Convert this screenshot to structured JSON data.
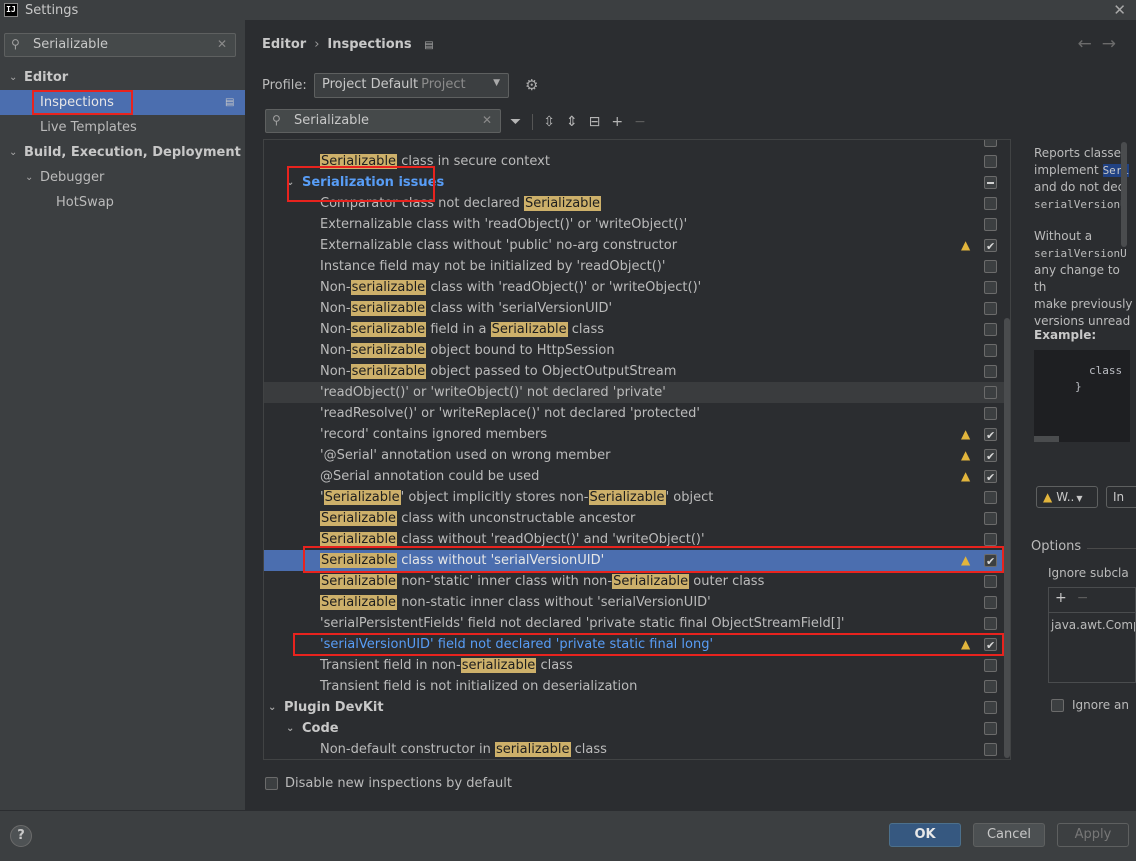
{
  "window": {
    "title": "Settings",
    "app_icon_text": "IJ"
  },
  "sidebar": {
    "search_value": "Serializable",
    "items": [
      {
        "label": "Editor"
      },
      {
        "label": "Inspections"
      },
      {
        "label": "Live Templates"
      },
      {
        "label": "Build, Execution, Deployment"
      },
      {
        "label": "Debugger"
      },
      {
        "label": "HotSwap"
      }
    ]
  },
  "breadcrumb": {
    "parent": "Editor",
    "current": "Inspections"
  },
  "profile": {
    "label": "Profile:",
    "value": "Project Default",
    "sub": "Project"
  },
  "inspection_search": {
    "value": "Serializable"
  },
  "list": {
    "partial_row": {
      "pre": "",
      "hl": "Serializable",
      "post": " class in secure context"
    },
    "group_serialization": "Serialization issues",
    "rows": [
      {
        "pre": "Comparator class not declared ",
        "hl": "Serializable",
        "post": ""
      },
      {
        "pre": "Externalizable class with 'readObject()' or 'writeObject()'",
        "hl": "",
        "post": ""
      },
      {
        "pre": "Externalizable class without 'public' no-arg constructor",
        "hl": "",
        "post": ""
      },
      {
        "pre": "Instance field may not be initialized by 'readObject()'",
        "hl": "",
        "post": ""
      },
      {
        "pre": "Non-",
        "hl": "serializable",
        "post": " class with 'readObject()' or 'writeObject()'"
      },
      {
        "pre": "Non-",
        "hl": "serializable",
        "post": " class with 'serialVersionUID'"
      },
      {
        "pre": "Non-",
        "hl": "serializable",
        "post": " field in a ",
        "hl2": "Serializable",
        "post2": " class"
      },
      {
        "pre": "Non-",
        "hl": "serializable",
        "post": " object bound to HttpSession"
      },
      {
        "pre": "Non-",
        "hl": "serializable",
        "post": " object passed to ObjectOutputStream"
      },
      {
        "pre": "'readObject()' or 'writeObject()' not declared 'private'",
        "hl": "",
        "post": ""
      },
      {
        "pre": "'readResolve()' or 'writeReplace()' not declared 'protected'",
        "hl": "",
        "post": ""
      },
      {
        "pre": "'record' contains ignored members",
        "hl": "",
        "post": ""
      },
      {
        "pre": "'@Serial' annotation used on wrong member",
        "hl": "",
        "post": ""
      },
      {
        "pre": "@Serial annotation could be used",
        "hl": "",
        "post": ""
      },
      {
        "pre": "'",
        "hl": "Serializable",
        "post": "' object implicitly stores non-",
        "hl2": "Serializable",
        "post2": "' object"
      },
      {
        "pre": "",
        "hl": "Serializable",
        "post": " class with unconstructable ancestor"
      },
      {
        "pre": "",
        "hl": "Serializable",
        "post": " class without 'readObject()' and 'writeObject()'"
      },
      {
        "pre": "",
        "hl": "Serializable",
        "post": " class without 'serialVersionUID'"
      },
      {
        "pre": "",
        "hl": "Serializable",
        "post": " non-'static' inner class with non-",
        "hl2": "Serializable",
        "post2": " outer class"
      },
      {
        "pre": "",
        "hl": "Serializable",
        "post": " non-static inner class without 'serialVersionUID'"
      },
      {
        "pre": "'serialPersistentFields' field not declared 'private static final ObjectStreamField[]'",
        "hl": "",
        "post": ""
      },
      {
        "pre": "'serialVersionUID' field not declared 'private static final long'",
        "hl": "",
        "post": ""
      },
      {
        "pre": "Transient field in non-",
        "hl": "serializable",
        "post": " class"
      },
      {
        "pre": "Transient field is not initialized on deserialization",
        "hl": "",
        "post": ""
      }
    ],
    "group_plugin": "Plugin DevKit",
    "group_code": "Code",
    "last_row": {
      "pre": "Non-default constructor in ",
      "hl": "serializable",
      "post": " class"
    }
  },
  "disable_new_label": "Disable new inspections by default",
  "description": {
    "p1_a": "Reports classes",
    "p1_b": "implement ",
    "p1_sel": "Seri",
    "p1_c": "and do not decl",
    "p1_mono": "serialVersionU",
    "p2_a": "Without a",
    "p2_mono": "serialVersionU",
    "p2_b": "any change to th",
    "p2_c": "make previously",
    "p2_d": "versions unread",
    "example_label": "Example:",
    "example_line1": "class",
    "example_line2": "}"
  },
  "severity": {
    "label": "W..",
    "scope_label": "In"
  },
  "options": {
    "label": "Options",
    "ignore_subclasses": "Ignore subcla",
    "ignore_item": "java.awt.Comp",
    "ignore_anon": "Ignore an"
  },
  "buttons": {
    "ok": "OK",
    "cancel": "Cancel",
    "apply": "Apply",
    "help": "?"
  }
}
